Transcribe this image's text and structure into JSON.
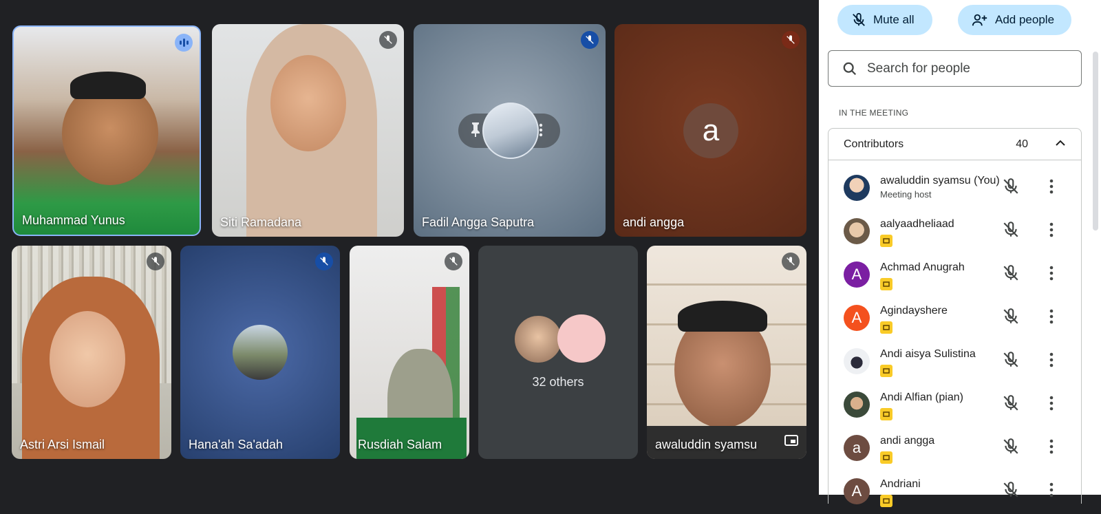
{
  "tiles": [
    {
      "name": "Muhammad Yunus"
    },
    {
      "name": "Siti Ramadana"
    },
    {
      "name": "Fadil Angga Saputra"
    },
    {
      "name": "andi angga",
      "initial": "a"
    },
    {
      "name": "Astri Arsi Ismail"
    },
    {
      "name": "Hana'ah Sa'adah"
    },
    {
      "name": "Rusdiah Salam"
    },
    {
      "others_label": "32 others"
    },
    {
      "name": "awaluddin syamsu"
    }
  ],
  "panel": {
    "mute_all_label": "Mute all",
    "add_people_label": "Add people",
    "search_placeholder": "Search for people",
    "section_label": "IN THE MEETING",
    "group_title": "Contributors",
    "group_count": "40",
    "participants": [
      {
        "name": "awaluddin syamsu (You)",
        "subtitle": "Meeting host"
      },
      {
        "name": "aalyaadheliaad"
      },
      {
        "name": "Achmad Anugrah",
        "initial": "A"
      },
      {
        "name": "Agindayshere",
        "initial": "A"
      },
      {
        "name": "Andi aisya Sulistina"
      },
      {
        "name": "Andi Alfian (pian)"
      },
      {
        "name": "andi angga",
        "initial": "a"
      },
      {
        "name": "Andriani",
        "initial": "A"
      }
    ]
  },
  "colors": {
    "stage_bg": "#202124",
    "pill_bg": "#c2e7ff",
    "avatar_purple": "#7b1fa2",
    "avatar_orange": "#f4511e",
    "avatar_brown": "#6d4c41",
    "badge_yellow": "#f9cb28"
  },
  "icons": {
    "mic_off": "mic-off-icon",
    "speaking": "speaking-indicator-icon",
    "search": "search-icon",
    "more": "more-vert-icon",
    "pin": "pin-icon",
    "person_add": "person-add-icon",
    "chevron": "chevron-up-icon",
    "screen": "screen-share-icon"
  }
}
